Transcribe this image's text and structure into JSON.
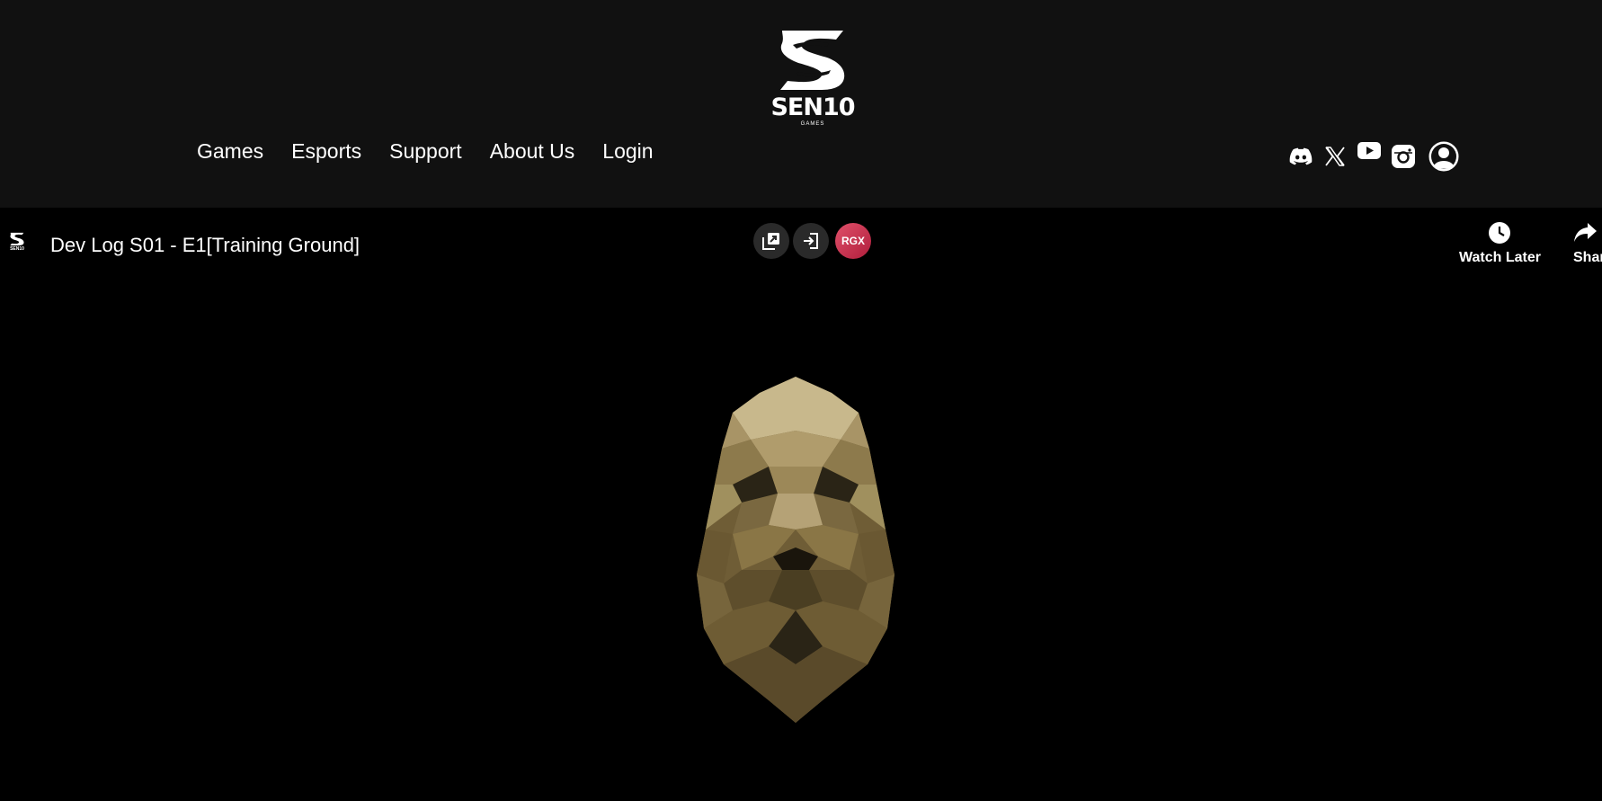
{
  "brand": {
    "logo_text": "SEN10",
    "logo_sub": "GAMES",
    "logo_color": "#ffffff"
  },
  "nav": {
    "items": [
      {
        "label": "Games"
      },
      {
        "label": "Esports"
      },
      {
        "label": "Support"
      },
      {
        "label": "About Us"
      },
      {
        "label": "Login"
      }
    ]
  },
  "socials": [
    "discord-icon",
    "x-icon",
    "youtube-icon",
    "instagram-icon",
    "account-icon"
  ],
  "player": {
    "title": "Dev Log S01 - E1[Training Ground]",
    "channel_logo_text": "SEN10",
    "controls": {
      "pip_icon": "picture-in-picture-icon",
      "enter_icon": "enter-icon",
      "rgx_label": "RGX"
    },
    "actions": {
      "watch_later": "Watch Later",
      "share": "Share"
    }
  },
  "colors": {
    "header_bg": "#111111",
    "video_bg": "#000000",
    "rgx_accent": "#d23c5a",
    "artwork_gold": "#8a7442"
  }
}
